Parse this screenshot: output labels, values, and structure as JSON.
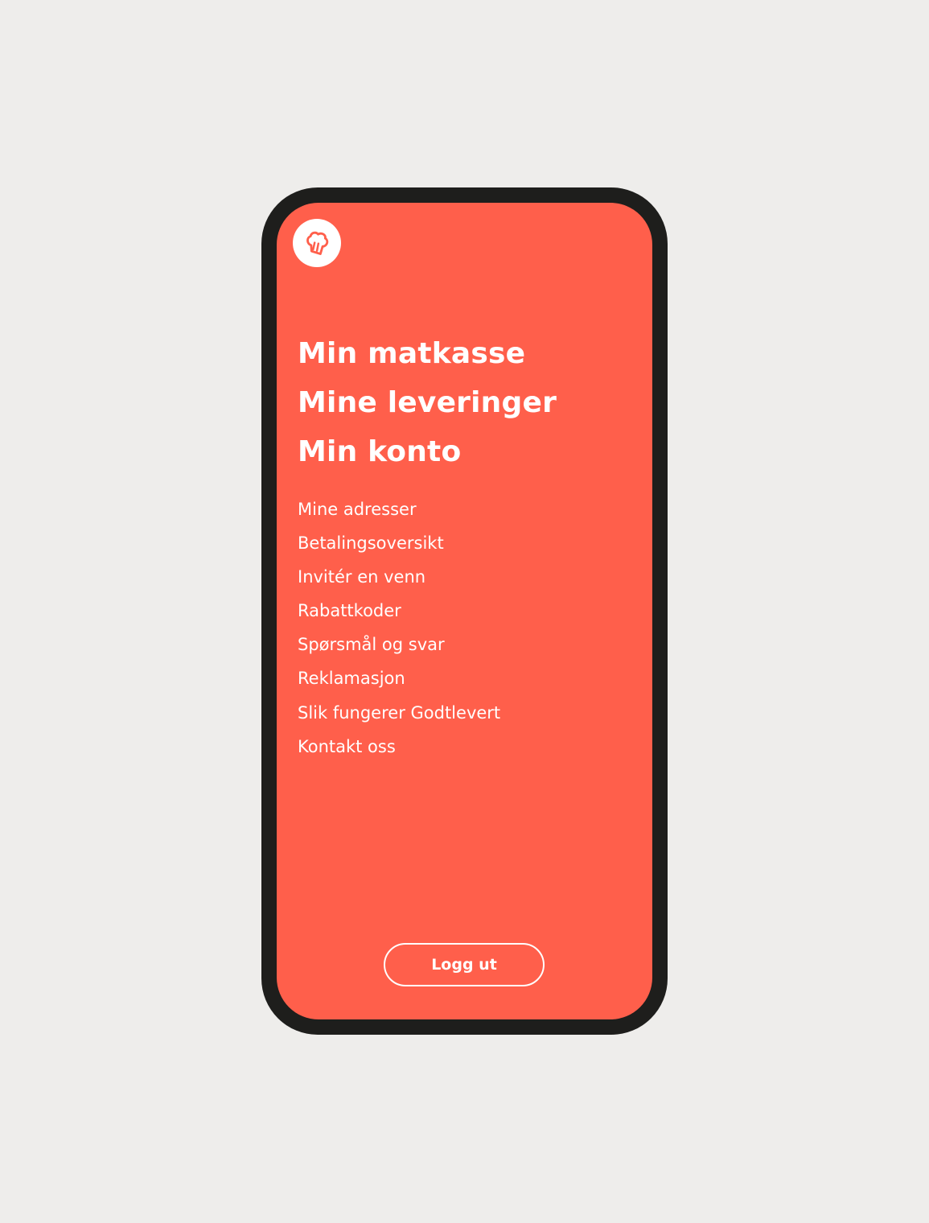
{
  "app": {
    "logo_icon": "chef-hat-icon",
    "accent_color": "#FF5F4B"
  },
  "nav": {
    "primary": [
      {
        "label": "Min matkasse"
      },
      {
        "label": "Mine leveringer"
      },
      {
        "label": "Min konto"
      }
    ],
    "secondary": [
      {
        "label": "Mine adresser"
      },
      {
        "label": "Betalingsoversikt"
      },
      {
        "label": "Invitér en venn"
      },
      {
        "label": "Rabattkoder"
      },
      {
        "label": "Spørsmål og svar"
      },
      {
        "label": "Reklamasjon"
      },
      {
        "label": "Slik fungerer Godtlevert"
      },
      {
        "label": "Kontakt oss"
      }
    ]
  },
  "footer": {
    "logout_label": "Logg ut"
  }
}
